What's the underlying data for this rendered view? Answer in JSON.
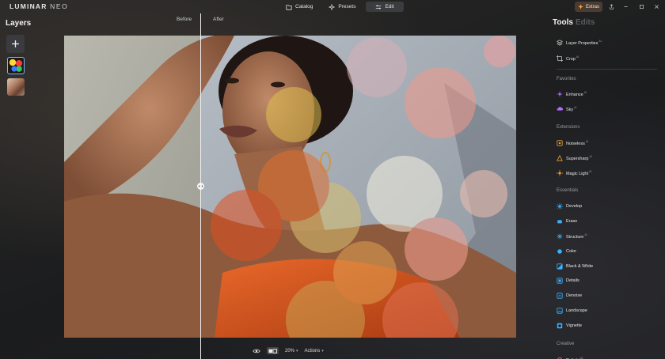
{
  "app": {
    "logo_main": "LUMINAR",
    "logo_sub": "NEO"
  },
  "topnav": {
    "catalog": "Catalog",
    "presets": "Presets",
    "edit": "Edit",
    "extras": "Extras"
  },
  "layers": {
    "title": "Layers"
  },
  "compare": {
    "before": "Before",
    "after": "After"
  },
  "bottombar": {
    "zoom": "20%",
    "actions": "Actions"
  },
  "tools_panel": {
    "tab_tools": "Tools",
    "tab_edits": "Edits",
    "ai_badge": "AI",
    "top_tools": [
      {
        "label": "Layer Properties",
        "ai": true,
        "icon": "layers-stack-icon",
        "color": "#bdbdbd"
      },
      {
        "label": "Crop",
        "ai": true,
        "icon": "crop-icon",
        "color": "#bdbdbd"
      }
    ],
    "sections": [
      {
        "title": "Favorites",
        "items": [
          {
            "label": "Enhance",
            "ai": true,
            "icon": "sparkle-icon",
            "color": "#b06cff"
          },
          {
            "label": "Sky",
            "ai": true,
            "icon": "cloud-icon",
            "color": "#b06cff"
          }
        ]
      },
      {
        "title": "Extensions",
        "items": [
          {
            "label": "Noiseless",
            "ai": true,
            "icon": "noiseless-icon",
            "color": "#f0a030"
          },
          {
            "label": "Supersharp",
            "ai": true,
            "icon": "supersharp-icon",
            "color": "#f0a030"
          },
          {
            "label": "Magic Light",
            "ai": true,
            "icon": "magic-light-icon",
            "color": "#f0a030"
          }
        ]
      },
      {
        "title": "Essentials",
        "items": [
          {
            "label": "Develop",
            "ai": false,
            "icon": "develop-icon",
            "color": "#3ab0ff"
          },
          {
            "label": "Erase",
            "ai": false,
            "icon": "eraser-icon",
            "color": "#3ab0ff"
          },
          {
            "label": "Structure",
            "ai": true,
            "icon": "structure-icon",
            "color": "#3ab0ff"
          },
          {
            "label": "Color",
            "ai": false,
            "icon": "color-icon",
            "color": "#3ab0ff"
          },
          {
            "label": "Black & White",
            "ai": false,
            "icon": "black-white-icon",
            "color": "#3ab0ff"
          },
          {
            "label": "Details",
            "ai": false,
            "icon": "details-icon",
            "color": "#3ab0ff"
          },
          {
            "label": "Denoise",
            "ai": false,
            "icon": "denoise-icon",
            "color": "#3ab0ff"
          },
          {
            "label": "Landscape",
            "ai": false,
            "icon": "landscape-icon",
            "color": "#3ab0ff"
          },
          {
            "label": "Vignette",
            "ai": false,
            "icon": "vignette-icon",
            "color": "#3ab0ff"
          }
        ]
      },
      {
        "title": "Creative",
        "items": [
          {
            "label": "Relight",
            "ai": true,
            "icon": "relight-icon",
            "color": "#ff6a6a"
          }
        ]
      }
    ]
  },
  "colors": {
    "accent_blue": "#3ab0ff",
    "favorite_purple": "#b06cff",
    "extension_orange": "#f0a030",
    "extras_bg": "#4a3c30"
  }
}
